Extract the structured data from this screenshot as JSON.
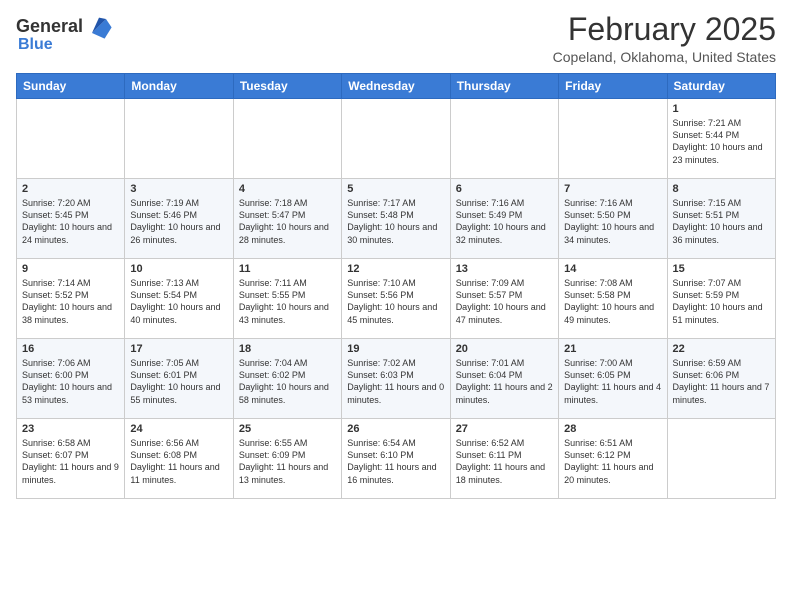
{
  "header": {
    "logo_general": "General",
    "logo_blue": "Blue",
    "month": "February 2025",
    "location": "Copeland, Oklahoma, United States"
  },
  "weekdays": [
    "Sunday",
    "Monday",
    "Tuesday",
    "Wednesday",
    "Thursday",
    "Friday",
    "Saturday"
  ],
  "weeks": [
    [
      {
        "day": "",
        "info": ""
      },
      {
        "day": "",
        "info": ""
      },
      {
        "day": "",
        "info": ""
      },
      {
        "day": "",
        "info": ""
      },
      {
        "day": "",
        "info": ""
      },
      {
        "day": "",
        "info": ""
      },
      {
        "day": "1",
        "info": "Sunrise: 7:21 AM\nSunset: 5:44 PM\nDaylight: 10 hours and 23 minutes."
      }
    ],
    [
      {
        "day": "2",
        "info": "Sunrise: 7:20 AM\nSunset: 5:45 PM\nDaylight: 10 hours and 24 minutes."
      },
      {
        "day": "3",
        "info": "Sunrise: 7:19 AM\nSunset: 5:46 PM\nDaylight: 10 hours and 26 minutes."
      },
      {
        "day": "4",
        "info": "Sunrise: 7:18 AM\nSunset: 5:47 PM\nDaylight: 10 hours and 28 minutes."
      },
      {
        "day": "5",
        "info": "Sunrise: 7:17 AM\nSunset: 5:48 PM\nDaylight: 10 hours and 30 minutes."
      },
      {
        "day": "6",
        "info": "Sunrise: 7:16 AM\nSunset: 5:49 PM\nDaylight: 10 hours and 32 minutes."
      },
      {
        "day": "7",
        "info": "Sunrise: 7:16 AM\nSunset: 5:50 PM\nDaylight: 10 hours and 34 minutes."
      },
      {
        "day": "8",
        "info": "Sunrise: 7:15 AM\nSunset: 5:51 PM\nDaylight: 10 hours and 36 minutes."
      }
    ],
    [
      {
        "day": "9",
        "info": "Sunrise: 7:14 AM\nSunset: 5:52 PM\nDaylight: 10 hours and 38 minutes."
      },
      {
        "day": "10",
        "info": "Sunrise: 7:13 AM\nSunset: 5:54 PM\nDaylight: 10 hours and 40 minutes."
      },
      {
        "day": "11",
        "info": "Sunrise: 7:11 AM\nSunset: 5:55 PM\nDaylight: 10 hours and 43 minutes."
      },
      {
        "day": "12",
        "info": "Sunrise: 7:10 AM\nSunset: 5:56 PM\nDaylight: 10 hours and 45 minutes."
      },
      {
        "day": "13",
        "info": "Sunrise: 7:09 AM\nSunset: 5:57 PM\nDaylight: 10 hours and 47 minutes."
      },
      {
        "day": "14",
        "info": "Sunrise: 7:08 AM\nSunset: 5:58 PM\nDaylight: 10 hours and 49 minutes."
      },
      {
        "day": "15",
        "info": "Sunrise: 7:07 AM\nSunset: 5:59 PM\nDaylight: 10 hours and 51 minutes."
      }
    ],
    [
      {
        "day": "16",
        "info": "Sunrise: 7:06 AM\nSunset: 6:00 PM\nDaylight: 10 hours and 53 minutes."
      },
      {
        "day": "17",
        "info": "Sunrise: 7:05 AM\nSunset: 6:01 PM\nDaylight: 10 hours and 55 minutes."
      },
      {
        "day": "18",
        "info": "Sunrise: 7:04 AM\nSunset: 6:02 PM\nDaylight: 10 hours and 58 minutes."
      },
      {
        "day": "19",
        "info": "Sunrise: 7:02 AM\nSunset: 6:03 PM\nDaylight: 11 hours and 0 minutes."
      },
      {
        "day": "20",
        "info": "Sunrise: 7:01 AM\nSunset: 6:04 PM\nDaylight: 11 hours and 2 minutes."
      },
      {
        "day": "21",
        "info": "Sunrise: 7:00 AM\nSunset: 6:05 PM\nDaylight: 11 hours and 4 minutes."
      },
      {
        "day": "22",
        "info": "Sunrise: 6:59 AM\nSunset: 6:06 PM\nDaylight: 11 hours and 7 minutes."
      }
    ],
    [
      {
        "day": "23",
        "info": "Sunrise: 6:58 AM\nSunset: 6:07 PM\nDaylight: 11 hours and 9 minutes."
      },
      {
        "day": "24",
        "info": "Sunrise: 6:56 AM\nSunset: 6:08 PM\nDaylight: 11 hours and 11 minutes."
      },
      {
        "day": "25",
        "info": "Sunrise: 6:55 AM\nSunset: 6:09 PM\nDaylight: 11 hours and 13 minutes."
      },
      {
        "day": "26",
        "info": "Sunrise: 6:54 AM\nSunset: 6:10 PM\nDaylight: 11 hours and 16 minutes."
      },
      {
        "day": "27",
        "info": "Sunrise: 6:52 AM\nSunset: 6:11 PM\nDaylight: 11 hours and 18 minutes."
      },
      {
        "day": "28",
        "info": "Sunrise: 6:51 AM\nSunset: 6:12 PM\nDaylight: 11 hours and 20 minutes."
      },
      {
        "day": "",
        "info": ""
      }
    ]
  ]
}
